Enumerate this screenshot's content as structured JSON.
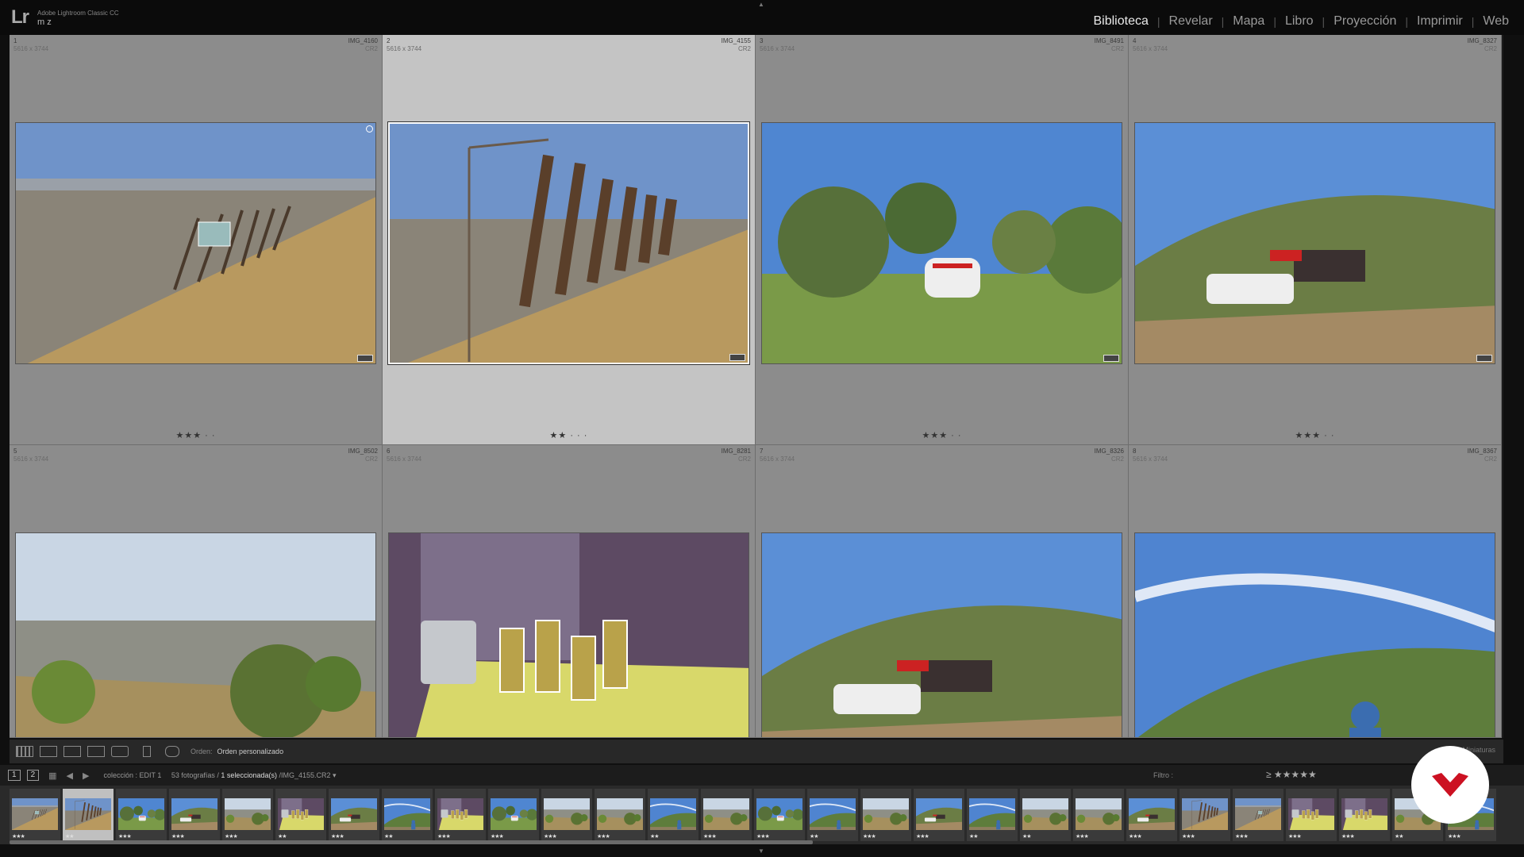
{
  "header": {
    "app_logo": "Lr",
    "app_name": "Adobe Lightroom Classic CC",
    "user": "m z",
    "modules": [
      {
        "label": "Biblioteca",
        "active": true
      },
      {
        "label": "Revelar",
        "active": false
      },
      {
        "label": "Mapa",
        "active": false
      },
      {
        "label": "Libro",
        "active": false
      },
      {
        "label": "Proyección",
        "active": false
      },
      {
        "label": "Imprimir",
        "active": false
      },
      {
        "label": "Web",
        "active": false
      }
    ]
  },
  "grid": {
    "cells": [
      {
        "index": "1",
        "file": "IMG_4160",
        "dims": "5616 x 3744",
        "ext": "CR2",
        "stars": "★★★ · ·",
        "selected": false,
        "scene": "sign-wide"
      },
      {
        "index": "2",
        "file": "IMG_4155",
        "dims": "5616 x 3744",
        "ext": "CR2",
        "stars": "★★ · · ·",
        "selected": true,
        "scene": "sign-close"
      },
      {
        "index": "3",
        "file": "IMG_8491",
        "dims": "5616 x 3744",
        "ext": "CR2",
        "stars": "★★★ · ·",
        "selected": false,
        "scene": "trees"
      },
      {
        "index": "4",
        "file": "IMG_8327",
        "dims": "5616 x 3744",
        "ext": "CR2",
        "stars": "★★★ · ·",
        "selected": false,
        "scene": "hill-car"
      },
      {
        "index": "5",
        "file": "IMG_8502",
        "dims": "5616 x 3744",
        "ext": "CR2",
        "stars": "",
        "selected": false,
        "scene": "city"
      },
      {
        "index": "6",
        "file": "IMG_8281",
        "dims": "5616 x 3744",
        "ext": "CR2",
        "stars": "",
        "selected": false,
        "scene": "table"
      },
      {
        "index": "7",
        "file": "IMG_8326",
        "dims": "5616 x 3744",
        "ext": "CR2",
        "stars": "",
        "selected": false,
        "scene": "hill-car"
      },
      {
        "index": "8",
        "file": "IMG_8367",
        "dims": "5616 x 3744",
        "ext": "CR2",
        "stars": "",
        "selected": false,
        "scene": "kite"
      }
    ]
  },
  "toolbar": {
    "sort_label": "Orden:",
    "sort_value": "Orden personalizado",
    "right_text": "Miniaturas"
  },
  "filmstrip_header": {
    "screen1": "1",
    "screen2": "2",
    "collection": "colección : EDIT 1",
    "count": "53 fotografías",
    "selected": "1 seleccionada(s)",
    "file": "/IMG_4155.CR2 ▾",
    "filter_label": "Filtro :",
    "filter_stars": "≥ ★★★★★"
  },
  "filmstrip": {
    "thumbs": [
      {
        "stars": "★★★",
        "scene": "sign-wide"
      },
      {
        "stars": "★★",
        "scene": "sign-close",
        "selected": true
      },
      {
        "stars": "★★★",
        "scene": "trees"
      },
      {
        "stars": "★★★",
        "scene": "hill-car"
      },
      {
        "stars": "★★★",
        "scene": "city"
      },
      {
        "stars": "★★",
        "scene": "table"
      },
      {
        "stars": "★★★",
        "scene": "hill-car"
      },
      {
        "stars": "★★",
        "scene": "kite"
      },
      {
        "stars": "★★★",
        "scene": "table"
      },
      {
        "stars": "★★★",
        "scene": "trees"
      },
      {
        "stars": "★★★",
        "scene": "city"
      },
      {
        "stars": "★★★",
        "scene": "city"
      },
      {
        "stars": "★★",
        "scene": "kite"
      },
      {
        "stars": "★★★",
        "scene": "city"
      },
      {
        "stars": "★★★",
        "scene": "trees"
      },
      {
        "stars": "★★",
        "scene": "kite"
      },
      {
        "stars": "★★★",
        "scene": "city"
      },
      {
        "stars": "★★★",
        "scene": "hill-car"
      },
      {
        "stars": "★★",
        "scene": "kite"
      },
      {
        "stars": "★★",
        "scene": "city"
      },
      {
        "stars": "★★★",
        "scene": "city"
      },
      {
        "stars": "★★★",
        "scene": "hill-car"
      },
      {
        "stars": "★★★",
        "scene": "sign-close"
      },
      {
        "stars": "★★★",
        "scene": "sign-wide"
      },
      {
        "stars": "★★★",
        "scene": "table"
      },
      {
        "stars": "★★★",
        "scene": "table"
      },
      {
        "stars": "★★",
        "scene": "city"
      },
      {
        "stars": "★★★",
        "scene": "kite"
      }
    ]
  },
  "colors": {
    "accent": "#e9e9e9",
    "cell_bg": "#8c8c8c",
    "cell_selected": "#c4c4c4",
    "watermark_red": "#cc1122"
  }
}
